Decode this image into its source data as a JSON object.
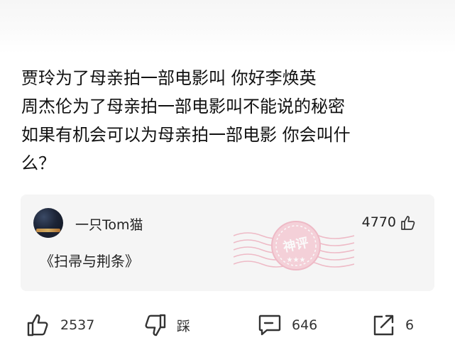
{
  "post": {
    "lines": [
      "贾玲为了母亲拍一部电影叫  你好李焕英",
      "周杰伦为了母亲拍一部电影叫不能说的秘密",
      "如果有机会可以为母亲拍一部电影 你会叫什",
      "么？"
    ]
  },
  "comment": {
    "username": "一只Tom猫",
    "likes": "4770",
    "text": "《扫帚与荆条》",
    "badge": "神评"
  },
  "actions": {
    "like_count": "2537",
    "dislike_label": "踩",
    "comment_count": "646",
    "share_count": "6"
  },
  "colors": {
    "stamp": "#e98aa0",
    "card_bg": "#f5f5f5"
  }
}
